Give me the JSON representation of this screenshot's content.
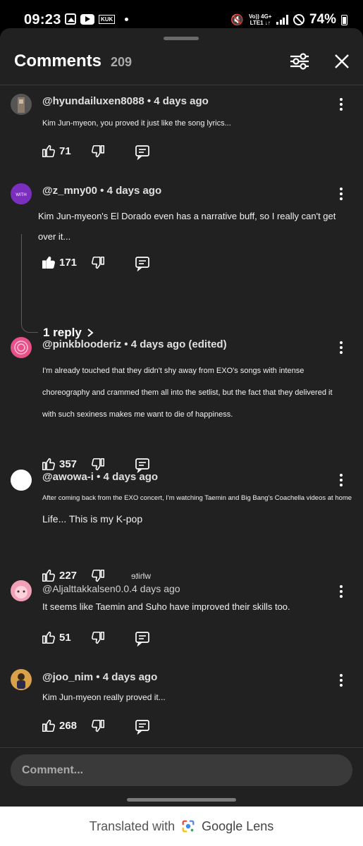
{
  "status_bar": {
    "time": "09:23",
    "app_icons": [
      "gallery-icon",
      "youtube-icon",
      "kuk-icon"
    ],
    "kuk_label": "KUK",
    "network_line1": "Vo)) 4G+",
    "network_line2": "LTE1 ↓↑",
    "battery": "74%"
  },
  "header": {
    "title": "Comments",
    "count": "209"
  },
  "comments": [
    {
      "avatar_color": "#555555",
      "author": "@hyundailuxen8088",
      "time": "4 days ago",
      "meta": "@hyundailuxen8088 • 4 days ago",
      "text": "Kim Jun-myeon, you proved it just like the song lyrics...",
      "likes": "71",
      "liked": false
    },
    {
      "avatar_color": "#7b2fbf",
      "avatar_label": "WITH",
      "author": "@z_mny00",
      "time": "4 days ago",
      "meta": "@z_mny00 • 4 days ago",
      "text": "Kim Jun-myeon's El Dorado even has a narrative buff, so I really can't get over it...",
      "likes": "171",
      "liked": true,
      "replies": "1 reply"
    },
    {
      "avatar_color": "#e8508a",
      "author": "@pinkblooderiz",
      "time": "4 days ago (edited)",
      "meta": "@pinkblooderiz • 4 days ago (edited)",
      "text": "I'm already touched that they didn't shy away from EXO's songs with intense choreography and crammed them all into the setlist, but the fact that they delivered it with such sexiness makes me want to die of happiness.",
      "likes": "357",
      "liked": false
    },
    {
      "avatar_color": "#ffffff",
      "author": "@awowa-i",
      "time": "4 days ago",
      "meta": "@awowa-i • 4 days ago",
      "text": "After coming back from the EXO concert, I'm watching Taemin and Big Bang's Coachella videos at home",
      "text2": "Life... This is my K-pop",
      "likes": "227",
      "liked": false,
      "overlay_text": "white"
    },
    {
      "avatar_color": "#f2a0b8",
      "author": "@Aljalttakkalsen0.0.4",
      "time": "days ago",
      "meta": "@Aljalttakkalsen0.0.4 days ago",
      "text": "It seems like Taemin and Suho have improved their skills too.",
      "likes": "51",
      "liked": false
    },
    {
      "avatar_color": "#d9a24a",
      "author": "@joo_nim",
      "time": "4 days ago",
      "meta": "@joo_nim • 4 days ago",
      "text": "Kim Jun-myeon really proved it...",
      "likes": "268",
      "liked": false
    }
  ],
  "input": {
    "placeholder": "Comment..."
  },
  "lens_bar": {
    "prefix": "Translated with",
    "brand": "Google Lens"
  },
  "colors": {
    "sheet_bg": "#212121",
    "text_primary": "#f1f1f1",
    "text_secondary": "#aaaaaa",
    "input_bg": "#3a3a3a"
  }
}
